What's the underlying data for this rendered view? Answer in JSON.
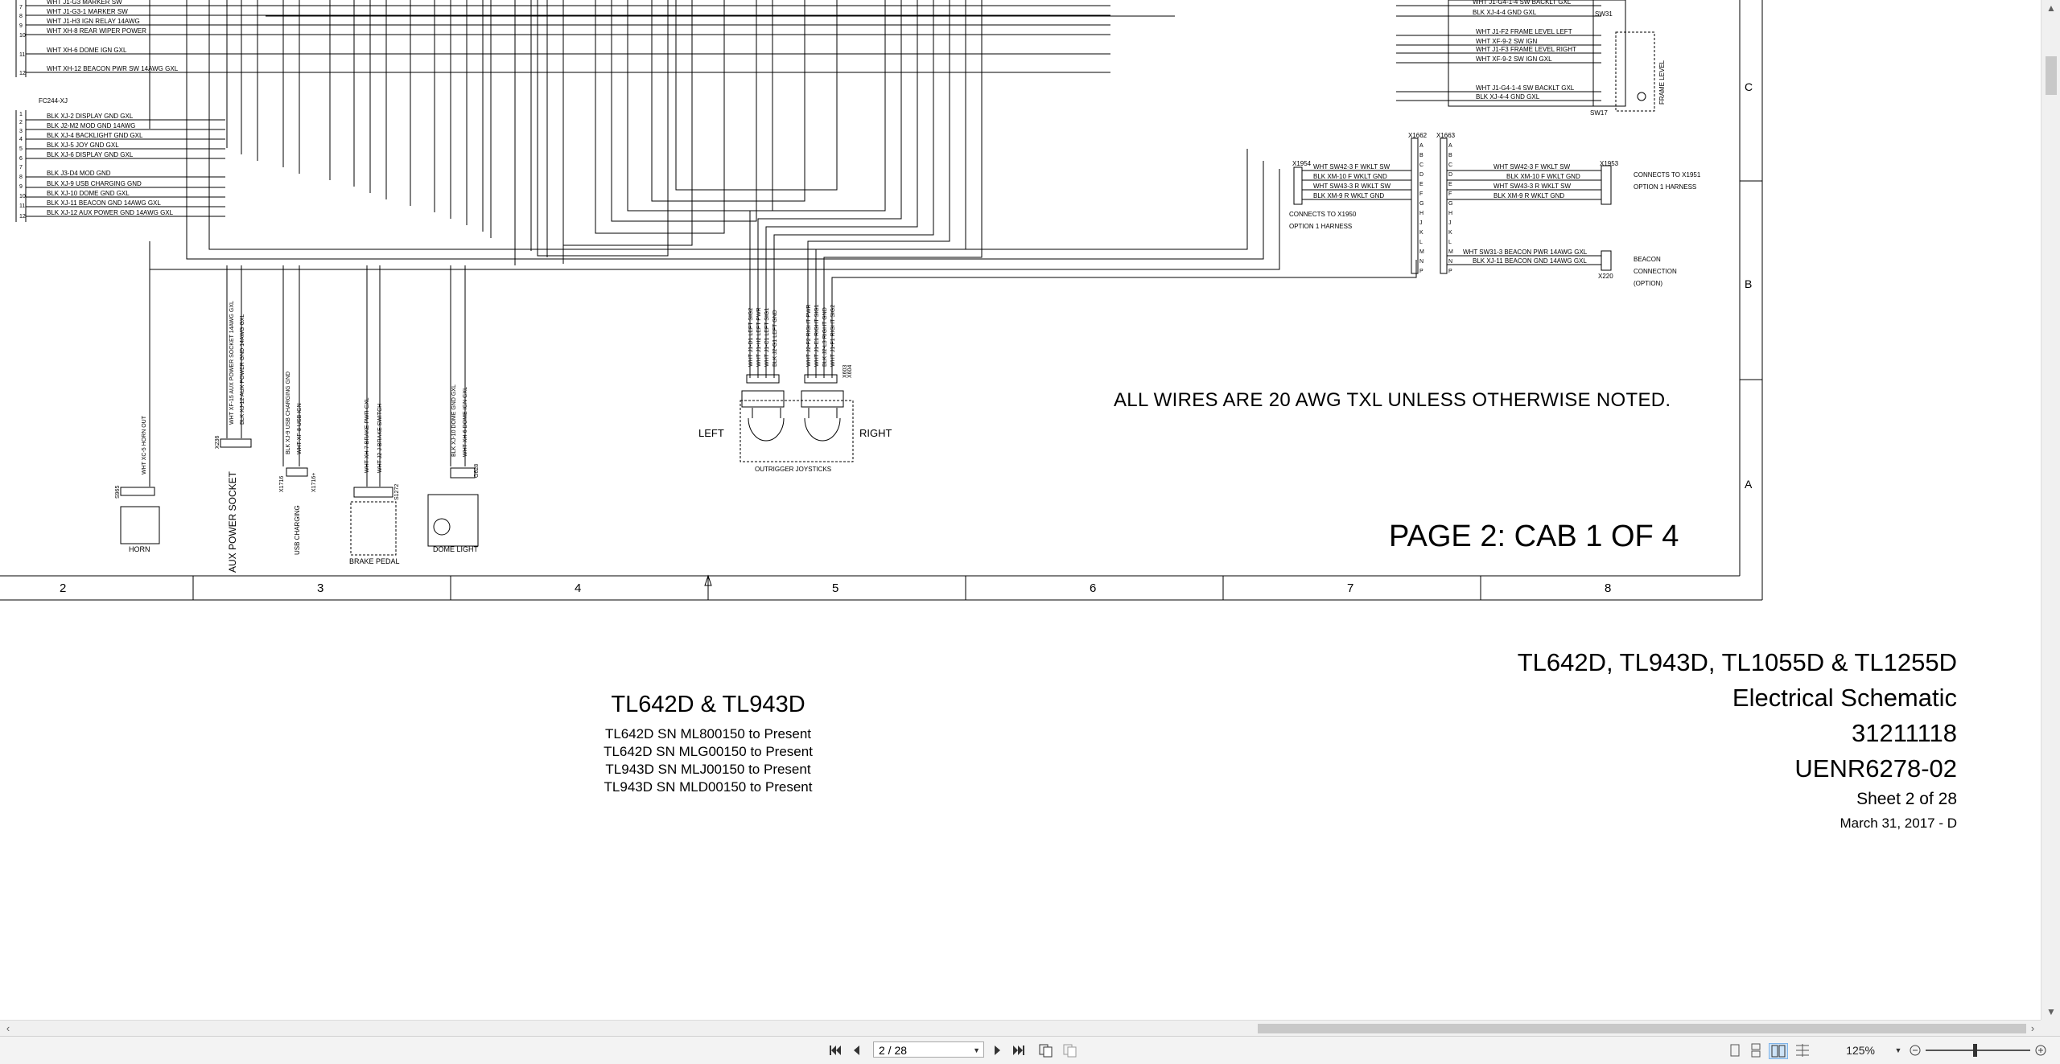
{
  "document": {
    "page_label": "PAGE 2: CAB 1 OF 4",
    "general_note": "ALL WIRES ARE 20 AWG TXL UNLESS OTHERWISE NOTED.",
    "zone_columns": [
      "2",
      "3",
      "4",
      "5",
      "6",
      "7",
      "8"
    ],
    "zone_rows": [
      "C",
      "B",
      "A"
    ],
    "left_connector_label": "FC244-XJ",
    "left_wires_top": [
      "WHT J1-G3 MARKER SW",
      "WHT J1-G3-1 MARKER SW",
      "WHT J1-H3 IGN RELAY 14AWG",
      "WHT XH-8 REAR WIPER POWER",
      "WHT XH-6 DOME IGN GXL",
      "WHT XH-12 BEACON PWR SW 14AWG GXL"
    ],
    "left_wires_bottom": [
      "BLK XJ-2 DISPLAY GND GXL",
      "BLK J2-M2 MOD GND 14AWG",
      "BLK XJ-4 BACKLIGHT GND GXL",
      "BLK XJ-5 JOY GND GXL",
      "BLK XJ-6 DISPLAY GND GXL",
      "BLK J3-D4 MOD GND",
      "BLK XJ-9 USB CHARGING GND",
      "BLK XJ-10 DOME GND GXL",
      "BLK XJ-11 BEACON GND 14AWG GXL",
      "BLK XJ-12 AUX POWER GND 14AWG GXL"
    ],
    "pins_top": [
      "7",
      "8",
      "9",
      "10",
      "11",
      "12"
    ],
    "pins_bottom": [
      "1",
      "2",
      "3",
      "4",
      "5",
      "6",
      "7",
      "8",
      "9",
      "10",
      "11",
      "12"
    ],
    "vertical_wires": [
      "WHT XC-5 HORN OUT",
      "WHT XF-15 AUX POWER SOCKET 14AWG GXL",
      "BLK XJ-12 AUX POWER GND 14AWG GXL",
      "BLK XJ-9 USB CHARGING GND",
      "WHT XF-8 USB IGN",
      "WHT XH-7 BRAKE PWR GXL",
      "WHT J2-J BRAKE SWITCH",
      "BLK XJ-10 DOME GND GXL",
      "WHT XH-6 DOME IGN GXL"
    ],
    "joystick_wires_left": [
      "WHT J1-D1 LEFT SIG2",
      "WHT J1-H2 LEFT PWR",
      "WHT J1-C1 LEFT SIG1",
      "BLK J2-G1 LEFT GND"
    ],
    "joystick_wires_right": [
      "WHT J2-F2 RIGHT PWR",
      "WHT J1-E1 RIGHT SIG1",
      "BLK J2-L3 RIGHT GND",
      "WHT J1-F1 RIGHT SIG2"
    ],
    "components": {
      "horn_id": "S965",
      "horn": "HORN",
      "aux_id": "X236",
      "aux": "AUX POWER SOCKET",
      "usb_id": "X1716",
      "usb_id2": "X1716+",
      "usb": "USB CHARGING",
      "brake_id": "S1272",
      "brake": "BRAKE PEDAL",
      "dome_id": "G628",
      "dome": "DOME LIGHT",
      "joy_left_id": "X603",
      "joy_right_id": "X604",
      "joy_left": "LEFT",
      "joy_right": "RIGHT",
      "joysticks": "OUTRIGGER JOYSTICKS"
    },
    "right_top": {
      "wires": [
        "WHT J1-G4-1-4 SW BACKLT GXL",
        "BLK XJ-4-4 GND GXL",
        "WHT J1-F2 FRAME LEVEL LEFT",
        "WHT XF-9-2 SW IGN",
        "WHT J1-F3 FRAME LEVEL RIGHT",
        "WHT XF-9-2 SW IGN GXL",
        "WHT J1-G4-1-4 SW BACKLT GXL",
        "BLK XJ-4-4 GND GXL"
      ],
      "sw31": "SW31",
      "sw17": "SW17",
      "frame_level": "FRAME LEVEL"
    },
    "right_mid": {
      "x1954": "X1954",
      "x1662": "X1662",
      "x1663": "X1663",
      "x1953": "X1953",
      "x220": "X220",
      "pins_letters": [
        "A",
        "B",
        "C",
        "D",
        "E",
        "F",
        "G",
        "H",
        "J",
        "K",
        "L",
        "M",
        "N",
        "P"
      ],
      "wires_left": [
        "WHT SW42-3 F WKLT SW",
        "BLK XM-10 F WKLT GND",
        "WHT SW43-3 R WKLT SW",
        "BLK XM-9 R WKLT GND"
      ],
      "wires_right": [
        "WHT SW42-3 F WKLT SW",
        "BLK XM-10 F WKLT GND",
        "WHT SW43-3 R WKLT SW",
        "BLK XM-9 R WKLT GND"
      ],
      "beacon_wires": [
        "WHT SW31-3 BEACON PWR 14AWG GXL",
        "BLK XJ-11 BEACON GND 14AWG GXL"
      ],
      "connects_left": [
        "CONNECTS TO X1950",
        "OPTION 1 HARNESS"
      ],
      "connects_right": [
        "CONNECTS TO X1951",
        "OPTION 1 HARNESS"
      ],
      "beacon_conn": [
        "BEACON",
        "CONNECTION",
        "(OPTION)"
      ]
    }
  },
  "title_block": {
    "center_title": "TL642D & TL943D",
    "serials": [
      "TL642D SN ML800150 to Present",
      "TL642D SN MLG00150 to Present",
      "TL943D SN MLJ00150 to Present",
      "TL943D SN MLD00150 to Present"
    ],
    "models": "TL642D, TL943D, TL1055D & TL1255D",
    "doc_type": "Electrical Schematic",
    "part_number": "31211118",
    "doc_number": "UENR6278-02",
    "sheet": "Sheet 2 of 28",
    "date": "March 31, 2017 - D"
  },
  "toolbar": {
    "page_field": "2 / 28",
    "zoom": "125%",
    "icons": [
      "first-page-icon",
      "prev-page-icon",
      "next-page-icon",
      "last-page-icon",
      "two-page-icon",
      "rotate-icon",
      "single-page-view-icon",
      "continuous-view-icon",
      "two-up-view-icon",
      "scroll-mode-icon",
      "zoom-out-icon",
      "zoom-in-icon"
    ]
  }
}
